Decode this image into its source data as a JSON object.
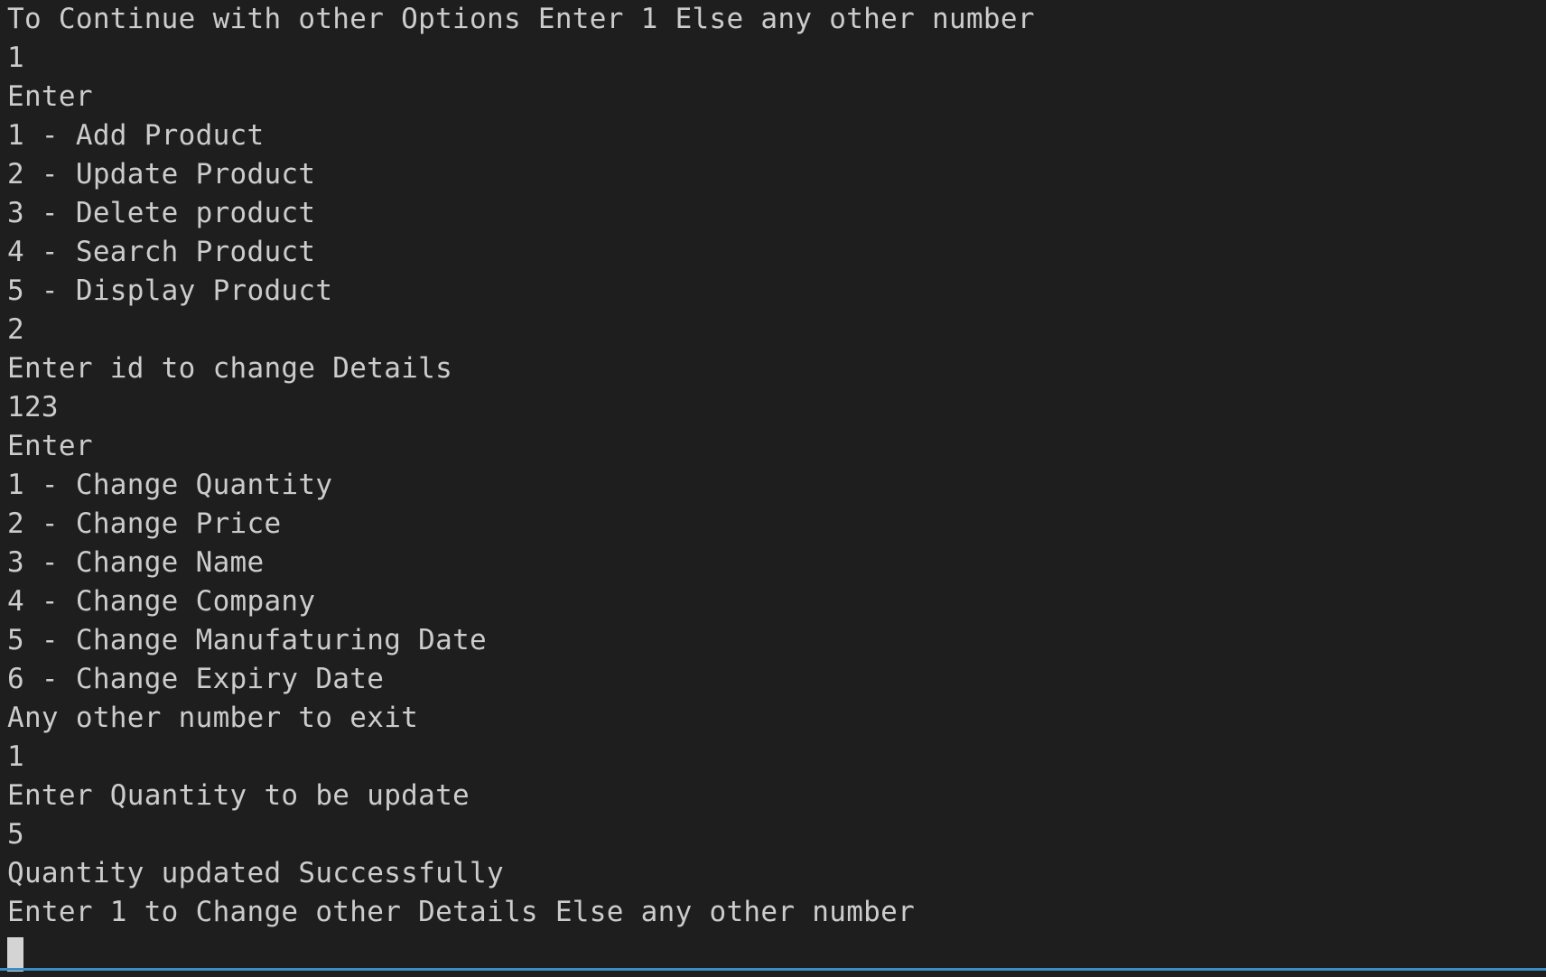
{
  "terminal": {
    "lines": [
      "To Continue with other Options Enter 1 Else any other number",
      "1",
      "Enter",
      "1 - Add Product",
      "2 - Update Product",
      "3 - Delete product",
      "4 - Search Product",
      "5 - Display Product",
      "2",
      "Enter id to change Details",
      "123",
      "Enter",
      "1 - Change Quantity",
      "2 - Change Price",
      "3 - Change Name",
      "4 - Change Company",
      "5 - Change Manufaturing Date",
      "6 - Change Expiry Date",
      "Any other number to exit",
      "1",
      "Enter Quantity to be update",
      "5",
      "Quantity updated Successfully",
      "Enter 1 to Change other Details Else any other number"
    ]
  },
  "colors": {
    "background": "#1e1e1e",
    "text": "#cccccc",
    "cursor": "#d4d4d4"
  }
}
